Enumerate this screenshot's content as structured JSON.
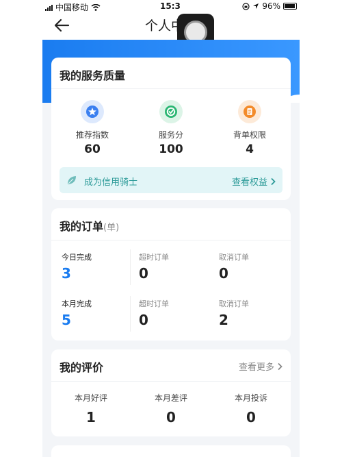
{
  "status_bar": {
    "carrier": "中国移动",
    "time": "15:3",
    "battery": "96%"
  },
  "nav": {
    "title": "个人中"
  },
  "service": {
    "title": "我的服务质量",
    "items": [
      {
        "icon": "star-icon",
        "label": "推荐指数",
        "value": "60",
        "color": "#3a7ff0"
      },
      {
        "icon": "check-icon",
        "label": "服务分",
        "value": "100",
        "color": "#2bb673"
      },
      {
        "icon": "document-icon",
        "label": "背单权限",
        "value": "4",
        "color": "#f38b2a"
      }
    ],
    "banner": {
      "label": "成为信用骑士",
      "link": "查看权益"
    }
  },
  "orders": {
    "title": "我的订单",
    "unit": "(单)",
    "rows": [
      {
        "label": "今日完成",
        "value": "3",
        "timeout_label": "超时订单",
        "timeout": "0",
        "cancel_label": "取消订单",
        "cancel": "0"
      },
      {
        "label": "本月完成",
        "value": "5",
        "timeout_label": "超时订单",
        "timeout": "0",
        "cancel_label": "取消订单",
        "cancel": "2"
      }
    ]
  },
  "reviews": {
    "title": "我的评价",
    "more": "查看更多",
    "items": [
      {
        "label": "本月好评",
        "value": "1"
      },
      {
        "label": "本月差评",
        "value": "0"
      },
      {
        "label": "本月投诉",
        "value": "0"
      }
    ]
  }
}
